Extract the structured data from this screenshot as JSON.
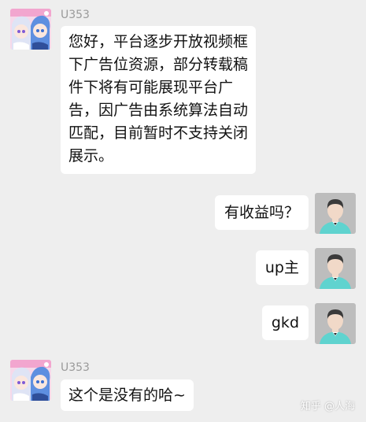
{
  "chat": {
    "messages": [
      {
        "sender": "U353",
        "side": "left",
        "lines": [
          "您好，平台逐步开放视频框",
          "下广告位资源，部分转载稿",
          "件下将有可能展现平台广",
          "告，因广告由系统算法自动",
          "匹配，目前暂时不支持关闭",
          "展示。"
        ]
      },
      {
        "side": "right",
        "text": "有收益吗？"
      },
      {
        "side": "right",
        "text": "up主"
      },
      {
        "side": "right",
        "text": "gkd"
      },
      {
        "sender": "U353",
        "side": "left",
        "text": "这个是没有的哈~"
      }
    ]
  },
  "watermark": "知乎 @人海",
  "colors": {
    "background": "#eeeeee",
    "bubble": "#ffffff",
    "sender_name": "#9a9a9a",
    "user_avatar_bg": "#bdbdbd",
    "user_avatar_shirt": "#5fd3cf"
  },
  "icons": {
    "support_avatar": "anime-girls-avatar",
    "user_avatar": "default-person-avatar"
  }
}
